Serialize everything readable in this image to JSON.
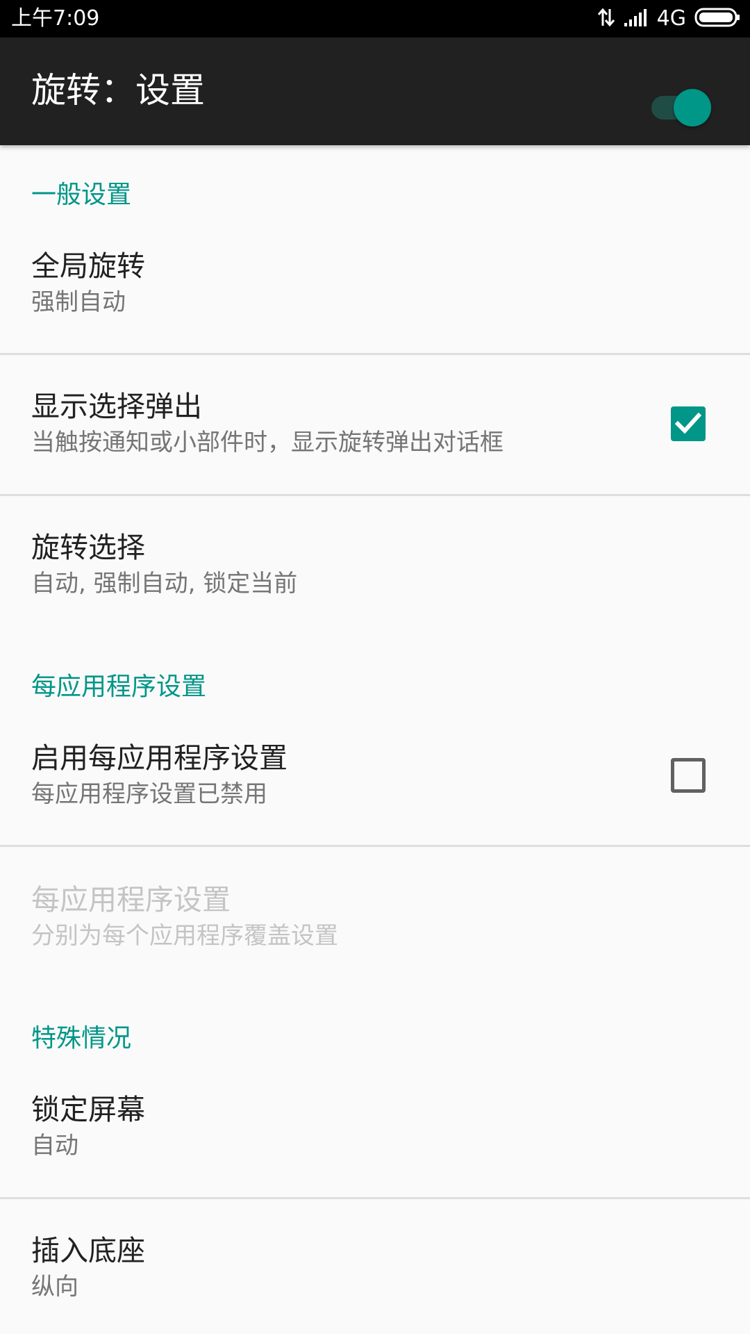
{
  "status_bar": {
    "time": "上午7:09",
    "network": "4G",
    "icons": [
      "data-transfer-icon",
      "signal-icon",
      "battery-icon"
    ]
  },
  "app_bar": {
    "title": "旋转：设置",
    "master_switch": {
      "on": true
    }
  },
  "sections": {
    "general": {
      "header": "一般设置",
      "global_rotation": {
        "title": "全局旋转",
        "summary": "强制自动"
      },
      "show_popup": {
        "title": "显示选择弹出",
        "summary": "当触按通知或小部件时，显示旋转弹出对话框",
        "checked": true
      },
      "rotation_choice": {
        "title": "旋转选择",
        "summary": "自动, 强制自动, 锁定当前"
      }
    },
    "per_app": {
      "header": "每应用程序设置",
      "enable": {
        "title": "启用每应用程序设置",
        "summary": "每应用程序设置已禁用",
        "checked": false
      },
      "settings": {
        "title": "每应用程序设置",
        "summary": "分别为每个应用程序覆盖设置",
        "enabled": false
      }
    },
    "special": {
      "header": "特殊情况",
      "lock_screen": {
        "title": "锁定屏幕",
        "summary": "自动"
      },
      "docked": {
        "title": "插入底座",
        "summary": "纵向"
      }
    }
  },
  "colors": {
    "accent": "#009688",
    "app_bar": "#212121",
    "background": "#fafafa"
  }
}
